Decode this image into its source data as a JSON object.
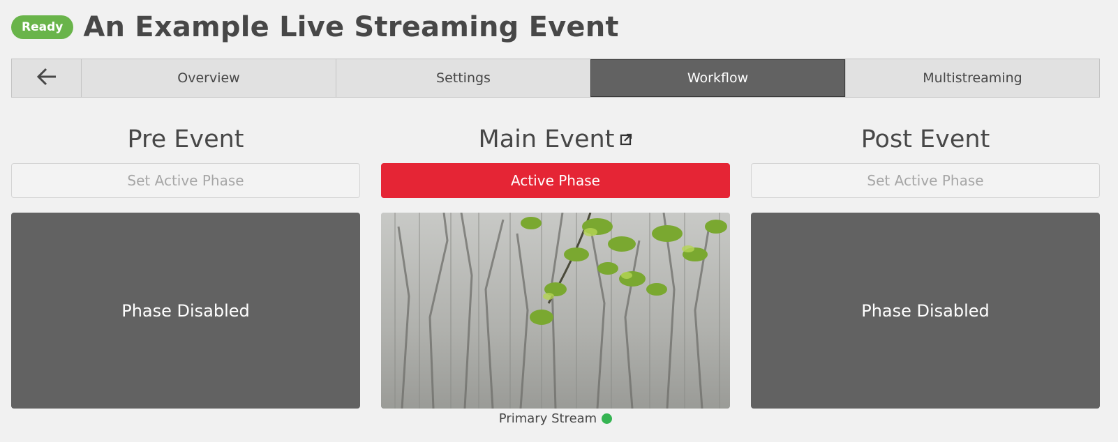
{
  "header": {
    "status_badge": "Ready",
    "title": "An Example Live Streaming Event"
  },
  "tabs": {
    "back_icon": "arrow-left-icon",
    "items": [
      {
        "label": "Overview"
      },
      {
        "label": "Settings"
      },
      {
        "label": "Workflow",
        "active": true
      },
      {
        "label": "Multistreaming"
      }
    ]
  },
  "phases": {
    "pre": {
      "title": "Pre Event",
      "button": "Set Active Phase",
      "preview_text": "Phase Disabled"
    },
    "main": {
      "title": "Main Event",
      "title_icon": "external-link-icon",
      "button": "Active Phase",
      "stream_label": "Primary Stream",
      "stream_status_color": "#35b452"
    },
    "post": {
      "title": "Post Event",
      "button": "Set Active Phase",
      "preview_text": "Phase Disabled"
    }
  },
  "colors": {
    "ready_badge": "#69b44a",
    "active_phase": "#e52535",
    "active_tab": "#626262"
  }
}
